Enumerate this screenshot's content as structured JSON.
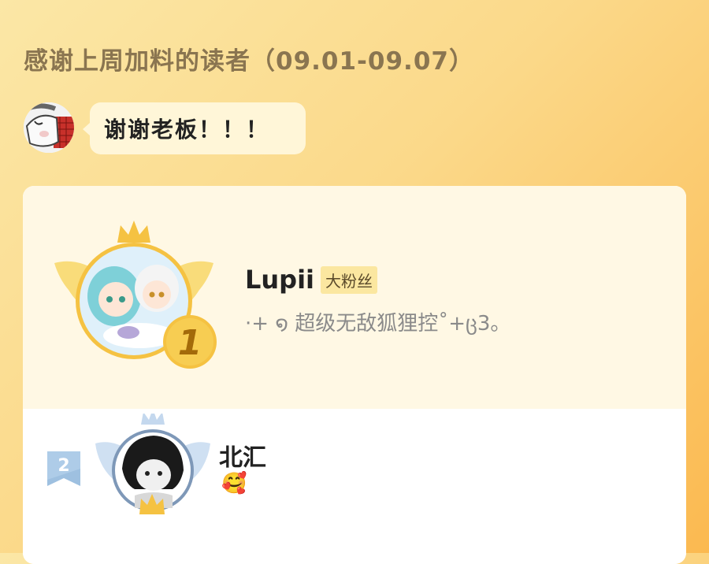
{
  "header": {
    "title": "感谢上周加料的读者（09.01-09.07）"
  },
  "author_message": {
    "text": "谢谢老板！！！"
  },
  "ranking": [
    {
      "rank": "1",
      "name": "Lupii",
      "badge": "大粉丝",
      "signature": "·+ ໑ 超级无敌狐狸控˚+ც3。"
    },
    {
      "rank": "2",
      "name": "北汇",
      "signature": "🥰"
    }
  ],
  "colors": {
    "gold": "#f5c242",
    "silver_blue": "#8aaed4",
    "title_text": "#8a7550"
  }
}
